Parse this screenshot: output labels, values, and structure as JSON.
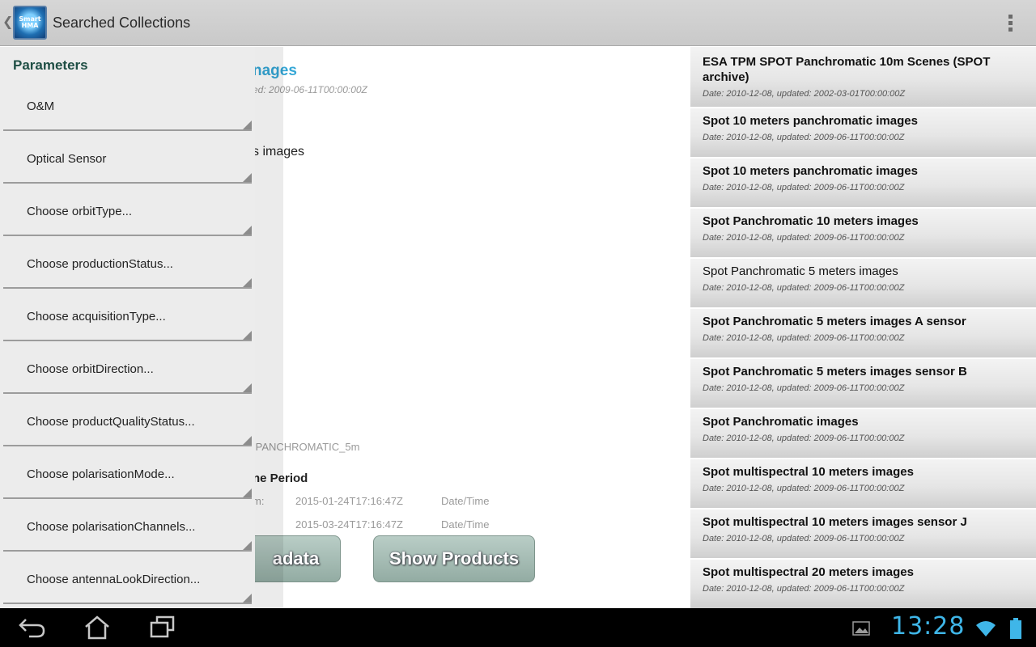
{
  "action_bar": {
    "title": "Searched Collections",
    "logo_text": "Smart HMA"
  },
  "drawer": {
    "header": "Parameters",
    "items": [
      {
        "label": "O&M"
      },
      {
        "label": "Optical Sensor"
      },
      {
        "label": "Choose orbitType..."
      },
      {
        "label": "Choose productionStatus..."
      },
      {
        "label": "Choose acquisitionType..."
      },
      {
        "label": "Choose orbitDirection..."
      },
      {
        "label": "Choose productQualityStatus..."
      },
      {
        "label": "Choose polarisationMode..."
      },
      {
        "label": "Choose polarisationChannels..."
      },
      {
        "label": "Choose antennaLookDirection..."
      }
    ]
  },
  "detail": {
    "title_fragment": "nages",
    "dates_fragment": "ed: 2009-06-11T00:00:00Z",
    "name_fragment": "s images",
    "identifier_fragment": ":PANCHROMATIC_5m",
    "time_heading_fragment": "ne Period",
    "from_label_fragment": "m:",
    "from_value": "2015-01-24T17:16:47Z",
    "from_unit": "Date/Time",
    "to_value": "2015-03-24T17:16:47Z",
    "to_unit": "Date/Time",
    "metadata_button_fragment": "adata",
    "show_products_button": "Show Products"
  },
  "collections": [
    {
      "title": "ESA TPM SPOT Panchromatic 10m Scenes (SPOT archive)",
      "date": "Date: 2010-12-08, updated: 2002-03-01T00:00:00Z"
    },
    {
      "title": "Spot 10 meters panchromatic images",
      "date": "Date: 2010-12-08, updated: 2009-06-11T00:00:00Z"
    },
    {
      "title": "Spot 10 meters panchromatic images",
      "date": "Date: 2010-12-08, updated: 2009-06-11T00:00:00Z"
    },
    {
      "title": "Spot Panchromatic 10 meters images",
      "date": "Date: 2010-12-08, updated: 2009-06-11T00:00:00Z"
    },
    {
      "title": "Spot Panchromatic 5 meters images",
      "date": "Date: 2010-12-08, updated: 2009-06-11T00:00:00Z",
      "selected": true
    },
    {
      "title": "Spot Panchromatic 5 meters images A sensor",
      "date": "Date: 2010-12-08, updated: 2009-06-11T00:00:00Z"
    },
    {
      "title": "Spot Panchromatic 5 meters images sensor B",
      "date": "Date: 2010-12-08, updated: 2009-06-11T00:00:00Z"
    },
    {
      "title": "Spot Panchromatic images",
      "date": "Date: 2010-12-08, updated: 2009-06-11T00:00:00Z"
    },
    {
      "title": "Spot multispectral 10 meters images",
      "date": "Date: 2010-12-08, updated: 2009-06-11T00:00:00Z"
    },
    {
      "title": "Spot multispectral 10 meters images sensor J",
      "date": "Date: 2010-12-08, updated: 2009-06-11T00:00:00Z"
    },
    {
      "title": "Spot multispectral 20 meters images",
      "date": "Date: 2010-12-08, updated: 2009-06-11T00:00:00Z"
    }
  ],
  "system_bar": {
    "clock": "13:28",
    "icons": [
      "back-icon",
      "home-icon",
      "recent-apps-icon",
      "gallery-icon",
      "wifi-icon",
      "battery-icon"
    ]
  },
  "colors": {
    "accent_blue": "#35a7d6",
    "button_green": "#9db5ac",
    "drawer_bg": "#ececec"
  }
}
